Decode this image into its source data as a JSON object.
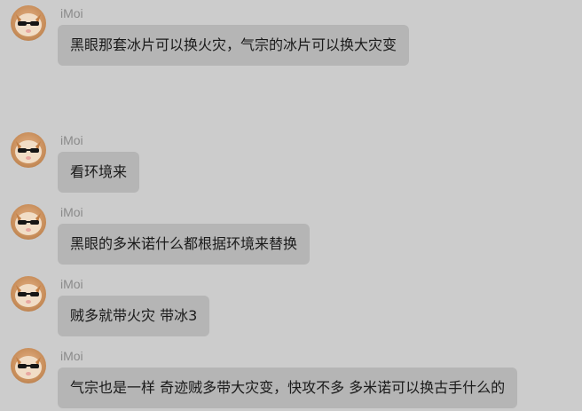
{
  "messages": [
    {
      "sender": "iMoi",
      "text": "黑眼那套冰片可以换火灾，气宗的冰片可以换大灾变"
    },
    {
      "sender": "iMoi",
      "text": "看环境来"
    },
    {
      "sender": "iMoi",
      "text": "黑眼的多米诺什么都根据环境来替换"
    },
    {
      "sender": "iMoi",
      "text": "贼多就带火灾 带冰3"
    },
    {
      "sender": "iMoi",
      "text": "气宗也是一样 奇迹贼多带大灾变，快攻不多 多米诺可以换古手什么的"
    }
  ],
  "colors": {
    "background": "#cccccc",
    "bubble": "#b5b5b5",
    "name": "#8a8a8a",
    "text": "#1a1a1a"
  },
  "icons": {
    "avatar": "cat-with-sunglasses-avatar-icon"
  }
}
